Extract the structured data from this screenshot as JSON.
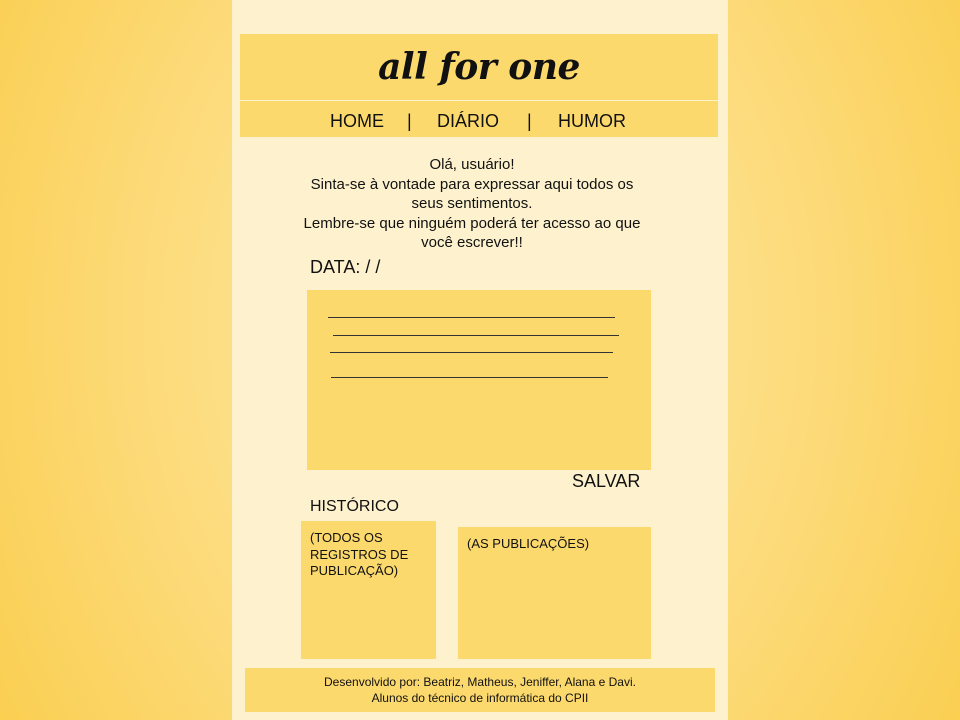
{
  "header": {
    "logo": "all for one"
  },
  "nav": {
    "home": "HOME",
    "separator_1": "|",
    "diary": "DIÁRIO",
    "separator_2": "|",
    "mood": "HUMOR"
  },
  "intro": {
    "lines": [
      "Olá, usuário!",
      "Sinta-se à vontade para expressar aqui todos os",
      "seus sentimentos.",
      "Lembre-se que ninguém poderá ter acesso ao que",
      "você escrever!!"
    ]
  },
  "diary_entry": {
    "date_label": "DATA:  /   /"
  },
  "actions": {
    "save_label": "SALVAR"
  },
  "history": {
    "title": "HISTÓRICO",
    "records_placeholder": "(TODOS OS REGISTROS DE PUBLICAÇÃO)",
    "posts_placeholder": "(AS PUBLICAÇÕES)"
  },
  "footer": {
    "line_1": "Desenvolvido por: Beatriz, Matheus, Jeniffer, Alana e Davi.",
    "line_2": "Alunos do técnico de informática do CPII"
  },
  "colors": {
    "background_outer": "#f9cd4c",
    "page_background": "#fef2ce",
    "panel": "#fcd96d",
    "text": "#111111"
  }
}
